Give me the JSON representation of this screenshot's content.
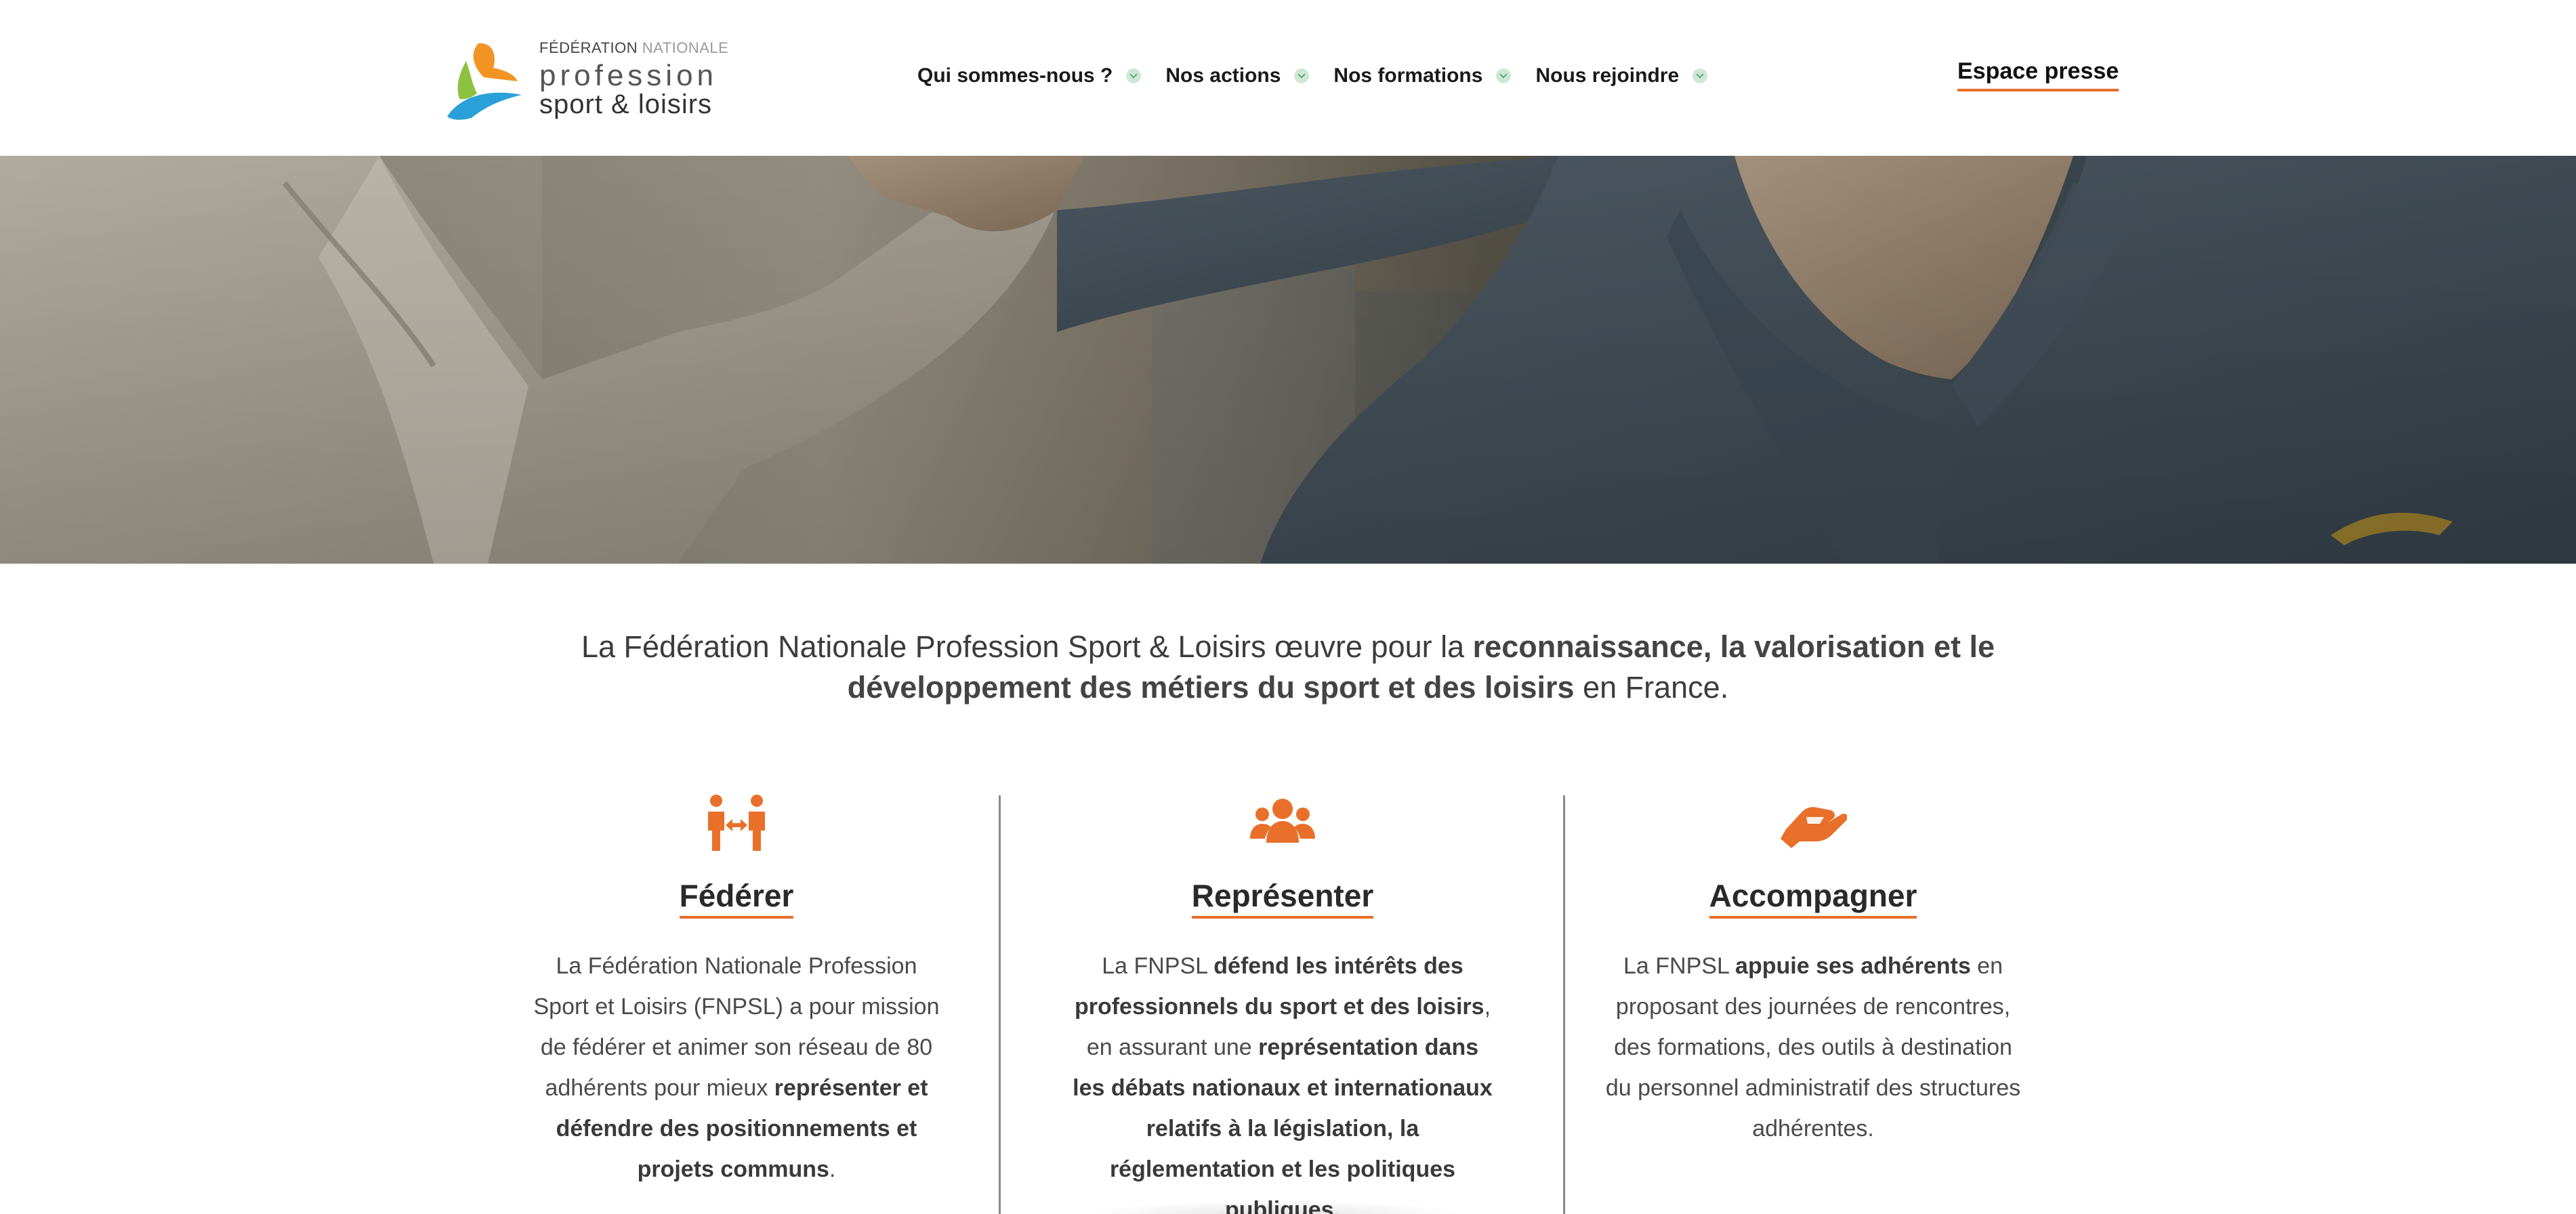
{
  "header": {
    "logo": {
      "federation_part1": "FÉDÉRATION",
      "federation_part2": "NATIONALE",
      "line1": "profession",
      "line2": "sport & loisirs",
      "colors": {
        "orange": "#f29423",
        "green": "#8cc23f",
        "blue": "#2ba0d8"
      }
    },
    "nav": [
      {
        "label": "Qui sommes-nous ?",
        "icon": "chevron-down-icon"
      },
      {
        "label": "Nos actions",
        "icon": "chevron-down-icon"
      },
      {
        "label": "Nos formations",
        "icon": "chevron-down-icon"
      },
      {
        "label": "Nous rejoindre",
        "icon": "chevron-down-icon"
      }
    ],
    "press_link": "Espace presse"
  },
  "hero": {
    "image": "judo-hero-photo"
  },
  "intro": {
    "text_before": "La Fédération Nationale Profession Sport & Loisirs œuvre pour la ",
    "text_bold": "reconnaissance, la valorisation et le développement des métiers du sport et des loisirs",
    "text_after": " en France."
  },
  "columns": [
    {
      "icon": "people-arrows-icon",
      "title": "Fédérer",
      "parts": [
        {
          "text": "La Fédération Nationale Profession Sport et Loisirs (FNPSL) a pour mission de fédérer et animer son réseau de 80 adhérents pour mieux ",
          "bold": false
        },
        {
          "text": "représenter et défendre des positionnements et projets communs",
          "bold": true
        },
        {
          "text": ".",
          "bold": false
        }
      ]
    },
    {
      "icon": "users-icon",
      "title": "Représenter",
      "parts": [
        {
          "text": "La FNPSL ",
          "bold": false
        },
        {
          "text": "défend les intérêts des professionnels du sport et des loisirs",
          "bold": true
        },
        {
          "text": ", en assurant une ",
          "bold": false
        },
        {
          "text": "représentation dans les débats nationaux et internationaux relatifs à la législation, la réglementation et les politiques publiques.",
          "bold": true
        }
      ]
    },
    {
      "icon": "hand-holding-icon",
      "title": "Accompagner",
      "parts": [
        {
          "text": "La FNPSL ",
          "bold": false
        },
        {
          "text": "appuie ses adhérents",
          "bold": true
        },
        {
          "text": " en proposant des journées de rencontres, des formations, des outils à destination du personnel administratif des structures adhérentes.",
          "bold": false
        }
      ]
    }
  ],
  "colors": {
    "accent": "#e8702a",
    "text": "#333333"
  }
}
